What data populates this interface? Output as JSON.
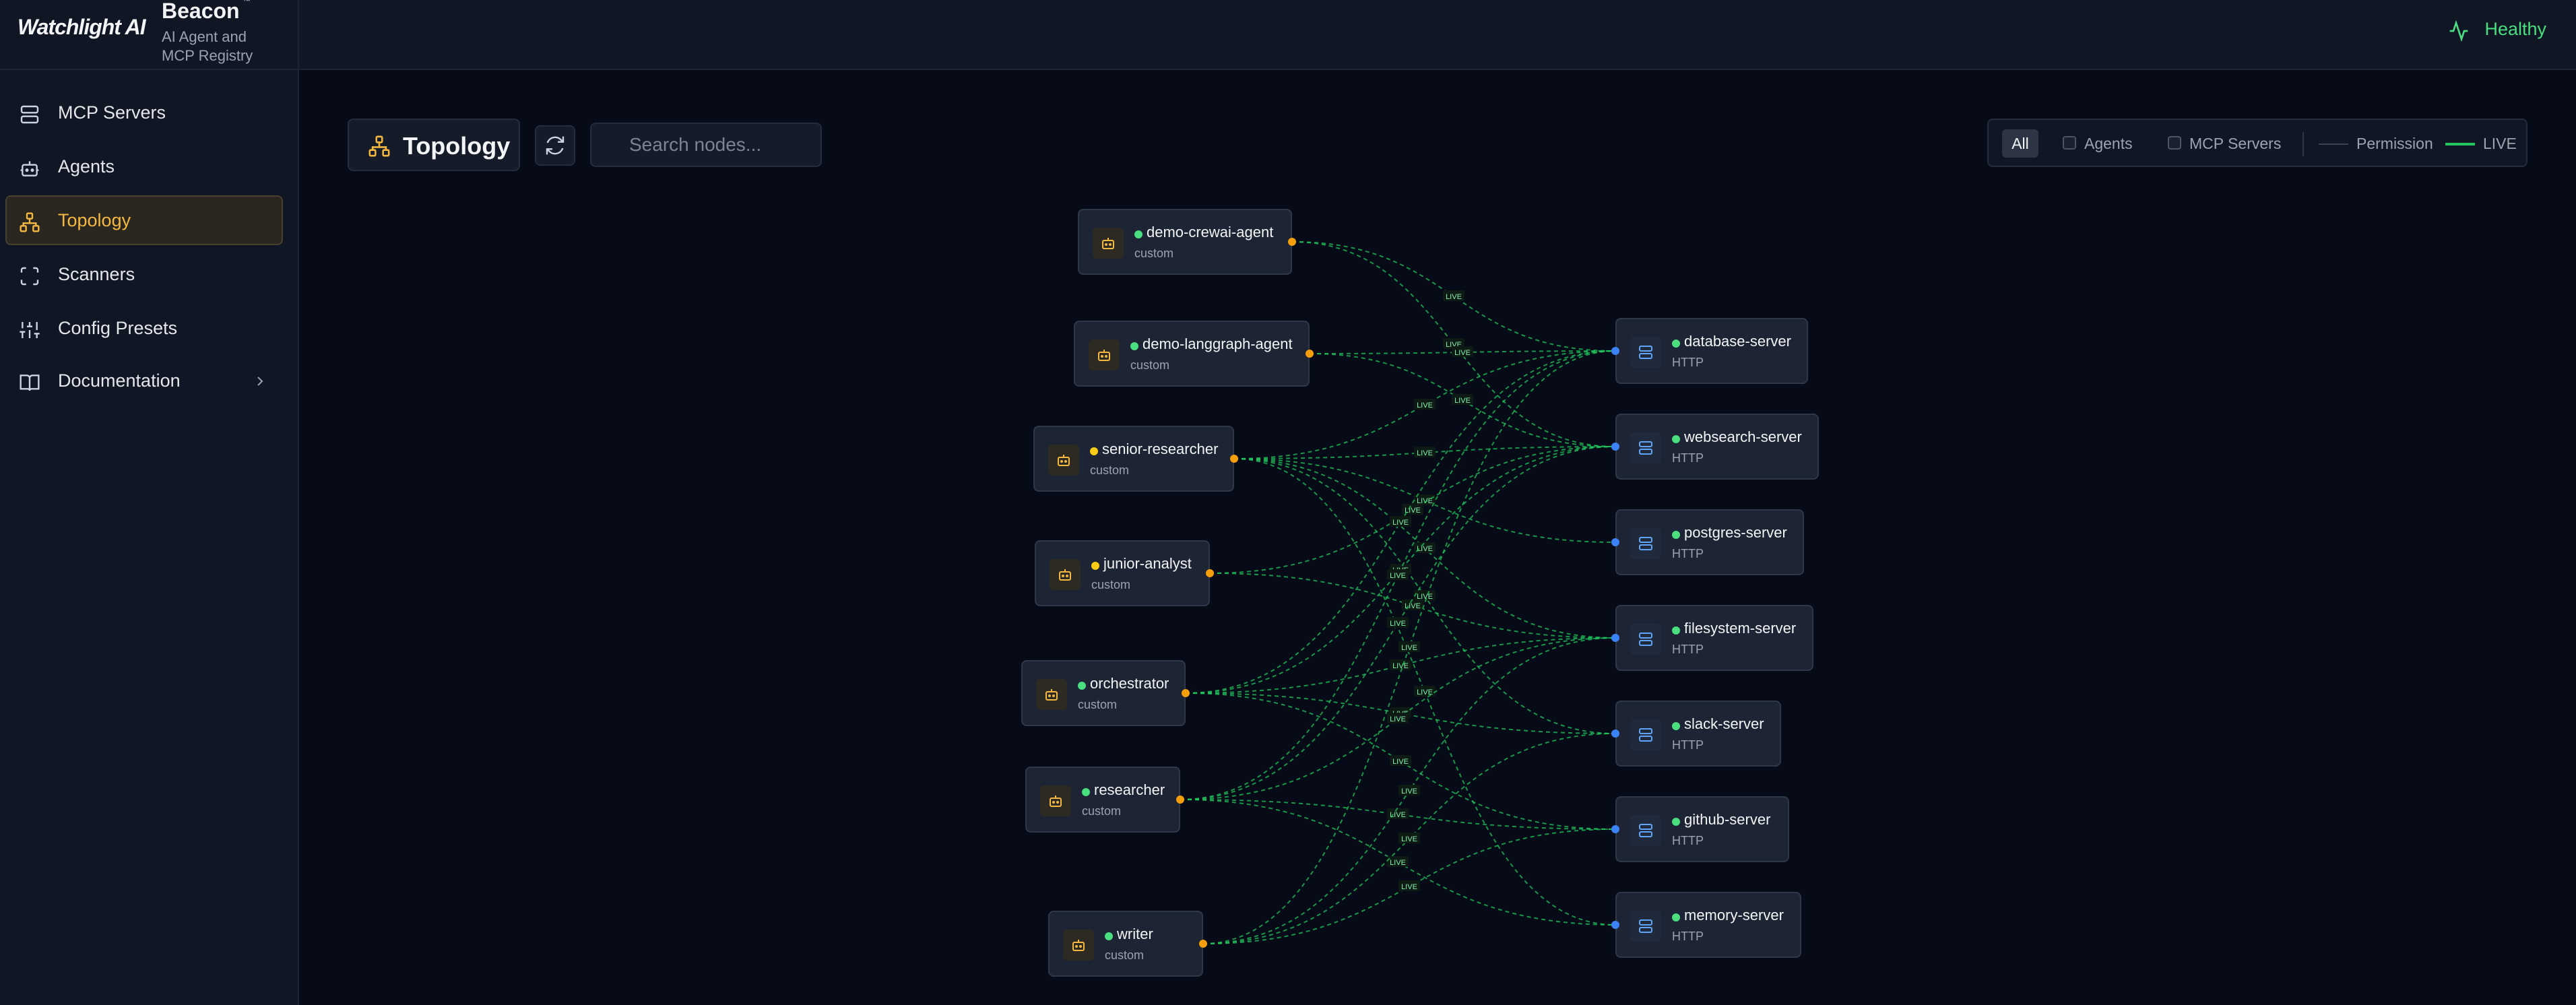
{
  "brand": {
    "logo": "Watchlight AI",
    "app_name": "Beacon",
    "tm": "™",
    "subtitle_line1": "AI Agent and",
    "subtitle_line2": "MCP Registry"
  },
  "sidebar": {
    "items": [
      {
        "label": "MCP Servers",
        "icon": "server-icon"
      },
      {
        "label": "Agents",
        "icon": "bot-icon"
      },
      {
        "label": "Topology",
        "icon": "topology-icon",
        "active": true
      },
      {
        "label": "Scanners",
        "icon": "scan-icon"
      },
      {
        "label": "Config Presets",
        "icon": "sliders-icon"
      },
      {
        "label": "Documentation",
        "icon": "book-icon",
        "has_submenu": true
      }
    ]
  },
  "header": {
    "status": "Healthy",
    "status_color": "#4ade80"
  },
  "toolbar": {
    "title": "Topology",
    "search_placeholder": "Search nodes...",
    "filters": {
      "all": "All",
      "agents": "Agents",
      "mcp_servers": "MCP Servers"
    },
    "legend": {
      "permission": "Permission",
      "live": "LIVE"
    }
  },
  "colors": {
    "accent": "#f5b942",
    "live_edge": "#22c55e",
    "agent_port": "#f59e0b",
    "server_port": "#3b82f6"
  },
  "agents": [
    {
      "name": "demo-crewai-agent",
      "type": "custom",
      "status": "#4ade80"
    },
    {
      "name": "demo-langgraph-agent",
      "type": "custom",
      "status": "#4ade80"
    },
    {
      "name": "senior-researcher",
      "type": "custom",
      "status": "#facc15"
    },
    {
      "name": "junior-analyst",
      "type": "custom",
      "status": "#facc15"
    },
    {
      "name": "orchestrator",
      "type": "custom",
      "status": "#4ade80"
    },
    {
      "name": "researcher",
      "type": "custom",
      "status": "#4ade80"
    },
    {
      "name": "writer",
      "type": "custom",
      "status": "#4ade80"
    }
  ],
  "servers": [
    {
      "name": "database-server",
      "type": "HTTP",
      "status": "#4ade80"
    },
    {
      "name": "websearch-server",
      "type": "HTTP",
      "status": "#4ade80"
    },
    {
      "name": "postgres-server",
      "type": "HTTP",
      "status": "#4ade80"
    },
    {
      "name": "filesystem-server",
      "type": "HTTP",
      "status": "#4ade80"
    },
    {
      "name": "slack-server",
      "type": "HTTP",
      "status": "#4ade80"
    },
    {
      "name": "github-server",
      "type": "HTTP",
      "status": "#4ade80"
    },
    {
      "name": "memory-server",
      "type": "HTTP",
      "status": "#4ade80"
    }
  ],
  "edges": [
    {
      "agent": 0,
      "server": 0,
      "label": "LIVE"
    },
    {
      "agent": 0,
      "server": 1,
      "label": "LIVE"
    },
    {
      "agent": 1,
      "server": 0,
      "label": "LIVE"
    },
    {
      "agent": 1,
      "server": 1,
      "label": "LIVE"
    },
    {
      "agent": 2,
      "server": 0,
      "label": "LIVE"
    },
    {
      "agent": 2,
      "server": 1,
      "label": "LIVE"
    },
    {
      "agent": 2,
      "server": 2,
      "label": "LIVE"
    },
    {
      "agent": 2,
      "server": 3,
      "label": "LIVE"
    },
    {
      "agent": 2,
      "server": 4,
      "label": "LIVE"
    },
    {
      "agent": 2,
      "server": 6,
      "label": "LIVE"
    },
    {
      "agent": 3,
      "server": 1,
      "label": "LIVE"
    },
    {
      "agent": 3,
      "server": 3,
      "label": "LIVE"
    },
    {
      "agent": 4,
      "server": 0,
      "label": "LIVE"
    },
    {
      "agent": 4,
      "server": 1,
      "label": "LIVE"
    },
    {
      "agent": 4,
      "server": 3,
      "label": "LIVE"
    },
    {
      "agent": 4,
      "server": 4,
      "label": "LIVE"
    },
    {
      "agent": 4,
      "server": 5,
      "label": "LIVE"
    },
    {
      "agent": 5,
      "server": 0,
      "label": "LIVE"
    },
    {
      "agent": 5,
      "server": 1,
      "label": "LIVE"
    },
    {
      "agent": 5,
      "server": 3,
      "label": "LIVE"
    },
    {
      "agent": 5,
      "server": 5,
      "label": "LIVE"
    },
    {
      "agent": 5,
      "server": 6,
      "label": "LIVE"
    },
    {
      "agent": 6,
      "server": 0,
      "label": "LIVE"
    },
    {
      "agent": 6,
      "server": 3,
      "label": "LIVE"
    },
    {
      "agent": 6,
      "server": 4,
      "label": "LIVE"
    },
    {
      "agent": 6,
      "server": 5,
      "label": "LIVE"
    }
  ]
}
